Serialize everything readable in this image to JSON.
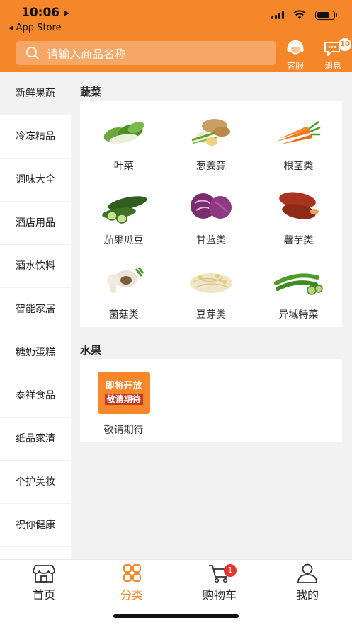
{
  "status": {
    "time": "10:06",
    "back": "◂ App Store"
  },
  "header": {
    "search_placeholder": "请输入商品名称",
    "service_label": "客服",
    "message_label": "消息",
    "message_badge": "10"
  },
  "sidebar": {
    "items": [
      {
        "label": "新鲜果蔬"
      },
      {
        "label": "冷冻精品"
      },
      {
        "label": "调味大全"
      },
      {
        "label": "酒店用品"
      },
      {
        "label": "酒水饮料"
      },
      {
        "label": "智能家居"
      },
      {
        "label": "糖奶蛋糕"
      },
      {
        "label": "泰祥食品"
      },
      {
        "label": "纸品家清"
      },
      {
        "label": "个护美妆"
      },
      {
        "label": "祝你健康"
      }
    ]
  },
  "vegetables": {
    "title": "蔬菜",
    "items": [
      {
        "label": "叶菜",
        "icon": "leafy-greens-icon"
      },
      {
        "label": "葱姜蒜",
        "icon": "ginger-garlic-icon"
      },
      {
        "label": "根茎类",
        "icon": "carrot-icon"
      },
      {
        "label": "茄果瓜豆",
        "icon": "cucumber-icon"
      },
      {
        "label": "甘蓝类",
        "icon": "cabbage-icon"
      },
      {
        "label": "薯芋类",
        "icon": "sweet-potato-icon"
      },
      {
        "label": "菌菇类",
        "icon": "mushroom-icon"
      },
      {
        "label": "豆芽类",
        "icon": "bean-sprout-icon"
      },
      {
        "label": "异域特菜",
        "icon": "okra-icon"
      }
    ]
  },
  "fruits": {
    "title": "水果",
    "items": [
      {
        "label": "敬请期待",
        "promo_line1": "即将开放",
        "promo_line2": "敬请期待"
      }
    ]
  },
  "tabbar": {
    "home": "首页",
    "category": "分类",
    "cart": "购物车",
    "cart_badge": "1",
    "mine": "我的"
  },
  "colors": {
    "accent": "#f5862a",
    "badge": "#e8332c"
  }
}
